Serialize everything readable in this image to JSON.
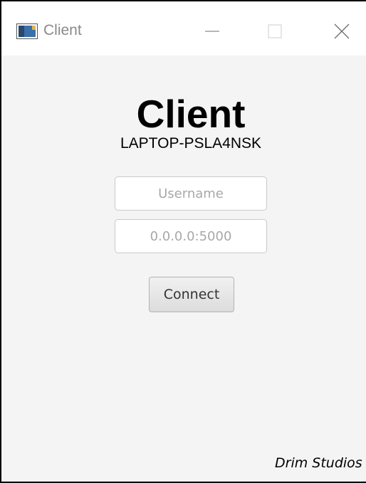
{
  "window": {
    "title": "Client",
    "controls": {
      "minimize_icon": "minimize-icon",
      "maximize_icon": "maximize-icon",
      "close_icon": "close-icon"
    }
  },
  "main": {
    "heading": "Client",
    "hostname": "LAPTOP-PSLA4NSK",
    "username": {
      "placeholder": "Username",
      "value": ""
    },
    "address": {
      "placeholder": "0.0.0.0:5000",
      "value": ""
    },
    "connect_label": "Connect"
  },
  "footer": {
    "credit": "Drim Studios"
  },
  "colors": {
    "background": "#f4f4f4",
    "titlebar": "#ffffff",
    "title_text": "#8a8a8a",
    "placeholder": "#a8a8a8"
  }
}
